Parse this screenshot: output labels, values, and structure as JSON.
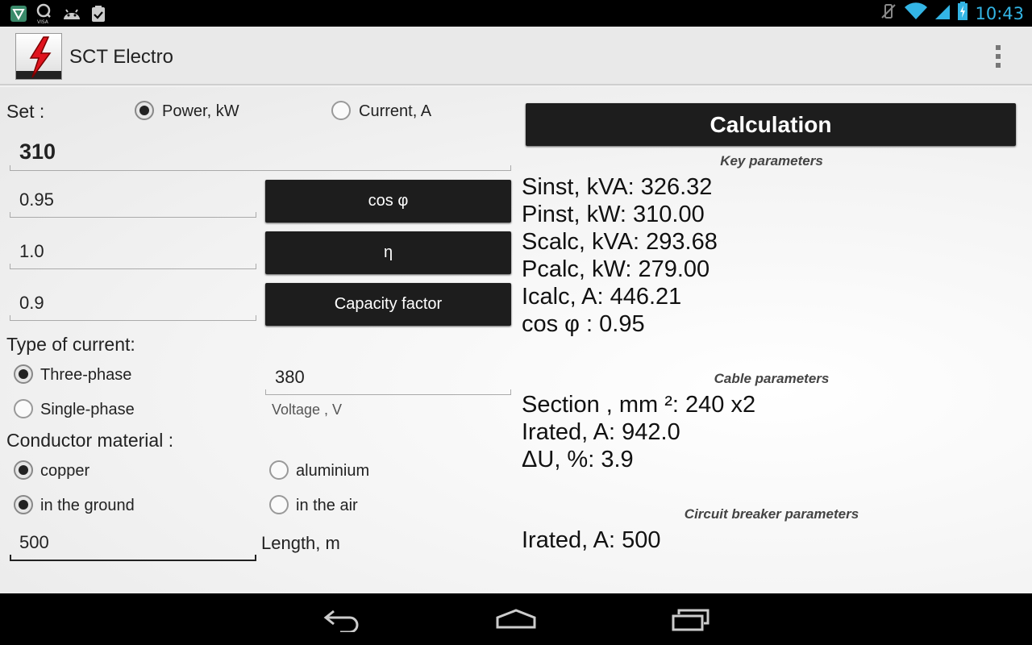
{
  "status_bar": {
    "time": "10:43",
    "left_icons": [
      "shield-app-icon",
      "visa-app-icon",
      "android-debug-icon",
      "clipboard-check-icon"
    ],
    "right_icons": [
      "no-vibrate-icon",
      "wifi-icon",
      "signal-icon",
      "battery-charging-icon"
    ]
  },
  "app_bar": {
    "title": "SCT Electro",
    "logo_icon": "lightning-bolt-icon",
    "menu_icon": "overflow-menu-icon"
  },
  "input_panel": {
    "set_label": "Set :",
    "set_options": [
      {
        "label": "Power, kW",
        "selected": true
      },
      {
        "label": "Current, A",
        "selected": false
      }
    ],
    "main_value": "310",
    "cos_phi_value": "0.95",
    "cos_phi_button": "cos φ",
    "eta_value": "1.0",
    "eta_button": "η",
    "capacity_value": "0.9",
    "capacity_button": "Capacity factor",
    "current_type_label": "Type of current:",
    "current_types": [
      {
        "label": "Three-phase",
        "selected": true
      },
      {
        "label": "Single-phase",
        "selected": false
      }
    ],
    "voltage_value": "380",
    "voltage_label": "Voltage , V",
    "conductor_label": "Conductor material :",
    "materials": [
      {
        "label": "copper",
        "selected": true
      },
      {
        "label": "aluminium",
        "selected": false
      }
    ],
    "placements": [
      {
        "label": "in the ground",
        "selected": true
      },
      {
        "label": "in the air",
        "selected": false
      }
    ],
    "length_value": "500",
    "length_label": "Length, m"
  },
  "results_panel": {
    "calculate_button": "Calculation",
    "key_params_title": "Key parameters",
    "key_params": [
      "Sinst, kVA: 326.32",
      "Pinst, kW: 310.00",
      "Scalc, kVA: 293.68",
      "Pcalc, kW: 279.00",
      "Icalc, A: 446.21",
      "cos φ : 0.95"
    ],
    "cable_params_title": "Cable parameters",
    "cable_params": [
      "Section , mm ²: 240 x2",
      "Irated, A: 942.0",
      "ΔU, %: 3.9"
    ],
    "breaker_params_title": "Circuit breaker parameters",
    "breaker_params": [
      "Irated, A: 500"
    ]
  },
  "nav_bar": {
    "icons": [
      "back-icon",
      "home-icon",
      "recent-apps-icon"
    ]
  },
  "colors": {
    "status_time": "#33b5e5",
    "button_bg": "#1d1d1d",
    "app_logo_red": "#e0141e"
  }
}
